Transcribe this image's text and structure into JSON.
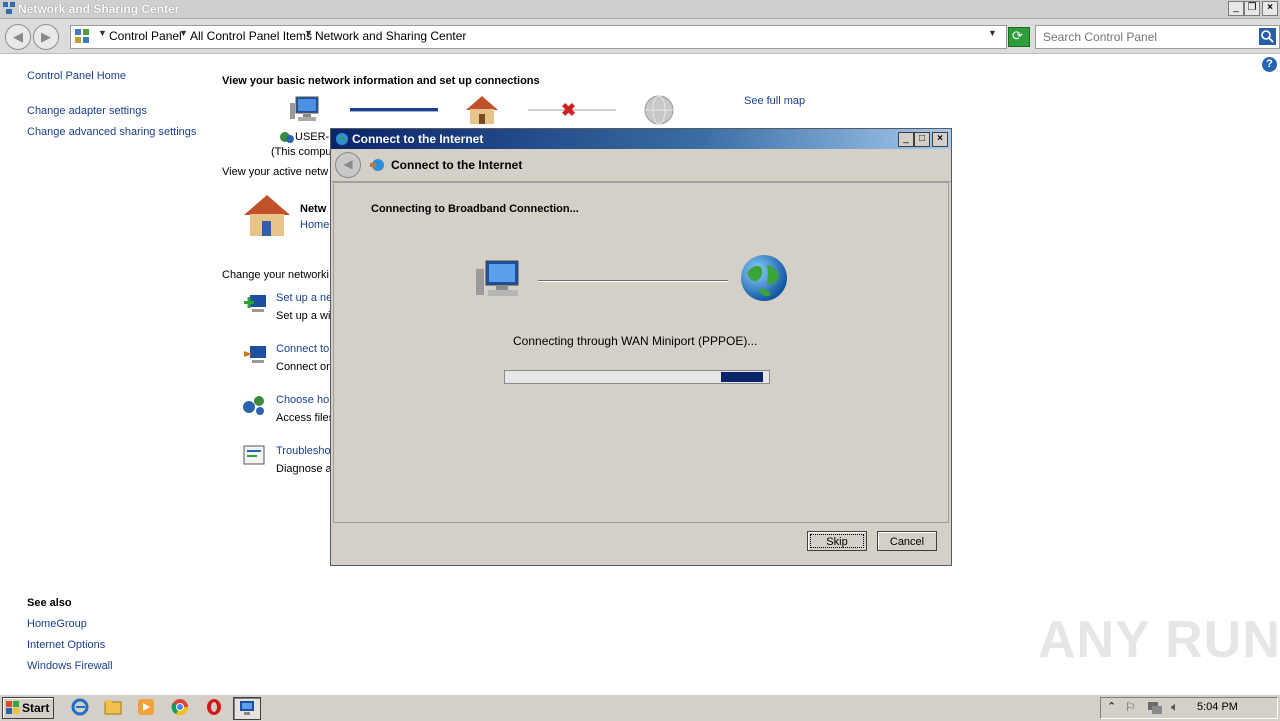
{
  "window": {
    "title": "Network and Sharing Center"
  },
  "address": {
    "crumbs": [
      "Control Panel",
      "All Control Panel Items",
      "Network and Sharing Center"
    ],
    "search_placeholder": "Search Control Panel"
  },
  "left_pane": {
    "home": "Control Panel Home",
    "links": [
      "Change adapter settings",
      "Change advanced sharing settings"
    ],
    "see_also_heading": "See also",
    "see_also": [
      "HomeGroup",
      "Internet Options",
      "Windows Firewall"
    ]
  },
  "main": {
    "heading": "View your basic network information and set up connections",
    "see_full_map": "See full map",
    "computer_name": "USER-F",
    "this_computer": "(This compu",
    "active_networks": "View your active netw",
    "network_name": "Netw",
    "network_type": "Home",
    "change_settings": "Change your networki",
    "tasks": [
      {
        "title": "Set up a ne",
        "desc": "Set up a wi"
      },
      {
        "title": "Connect to",
        "desc": "Connect or"
      },
      {
        "title": "Choose ho",
        "desc": "Access files"
      },
      {
        "title": "Troublesho",
        "desc": "Diagnose a"
      }
    ]
  },
  "dialog": {
    "title": "Connect to the Internet",
    "header": "Connect to the Internet",
    "status": "Connecting to Broadband Connection...",
    "detail": "Connecting through WAN Miniport (PPPOE)...",
    "progress_start": 0.82,
    "progress_end": 0.98,
    "skip": "Skip",
    "cancel": "Cancel"
  },
  "taskbar": {
    "start": "Start",
    "clock": "5:04 PM"
  },
  "watermark": "ANY RUN"
}
